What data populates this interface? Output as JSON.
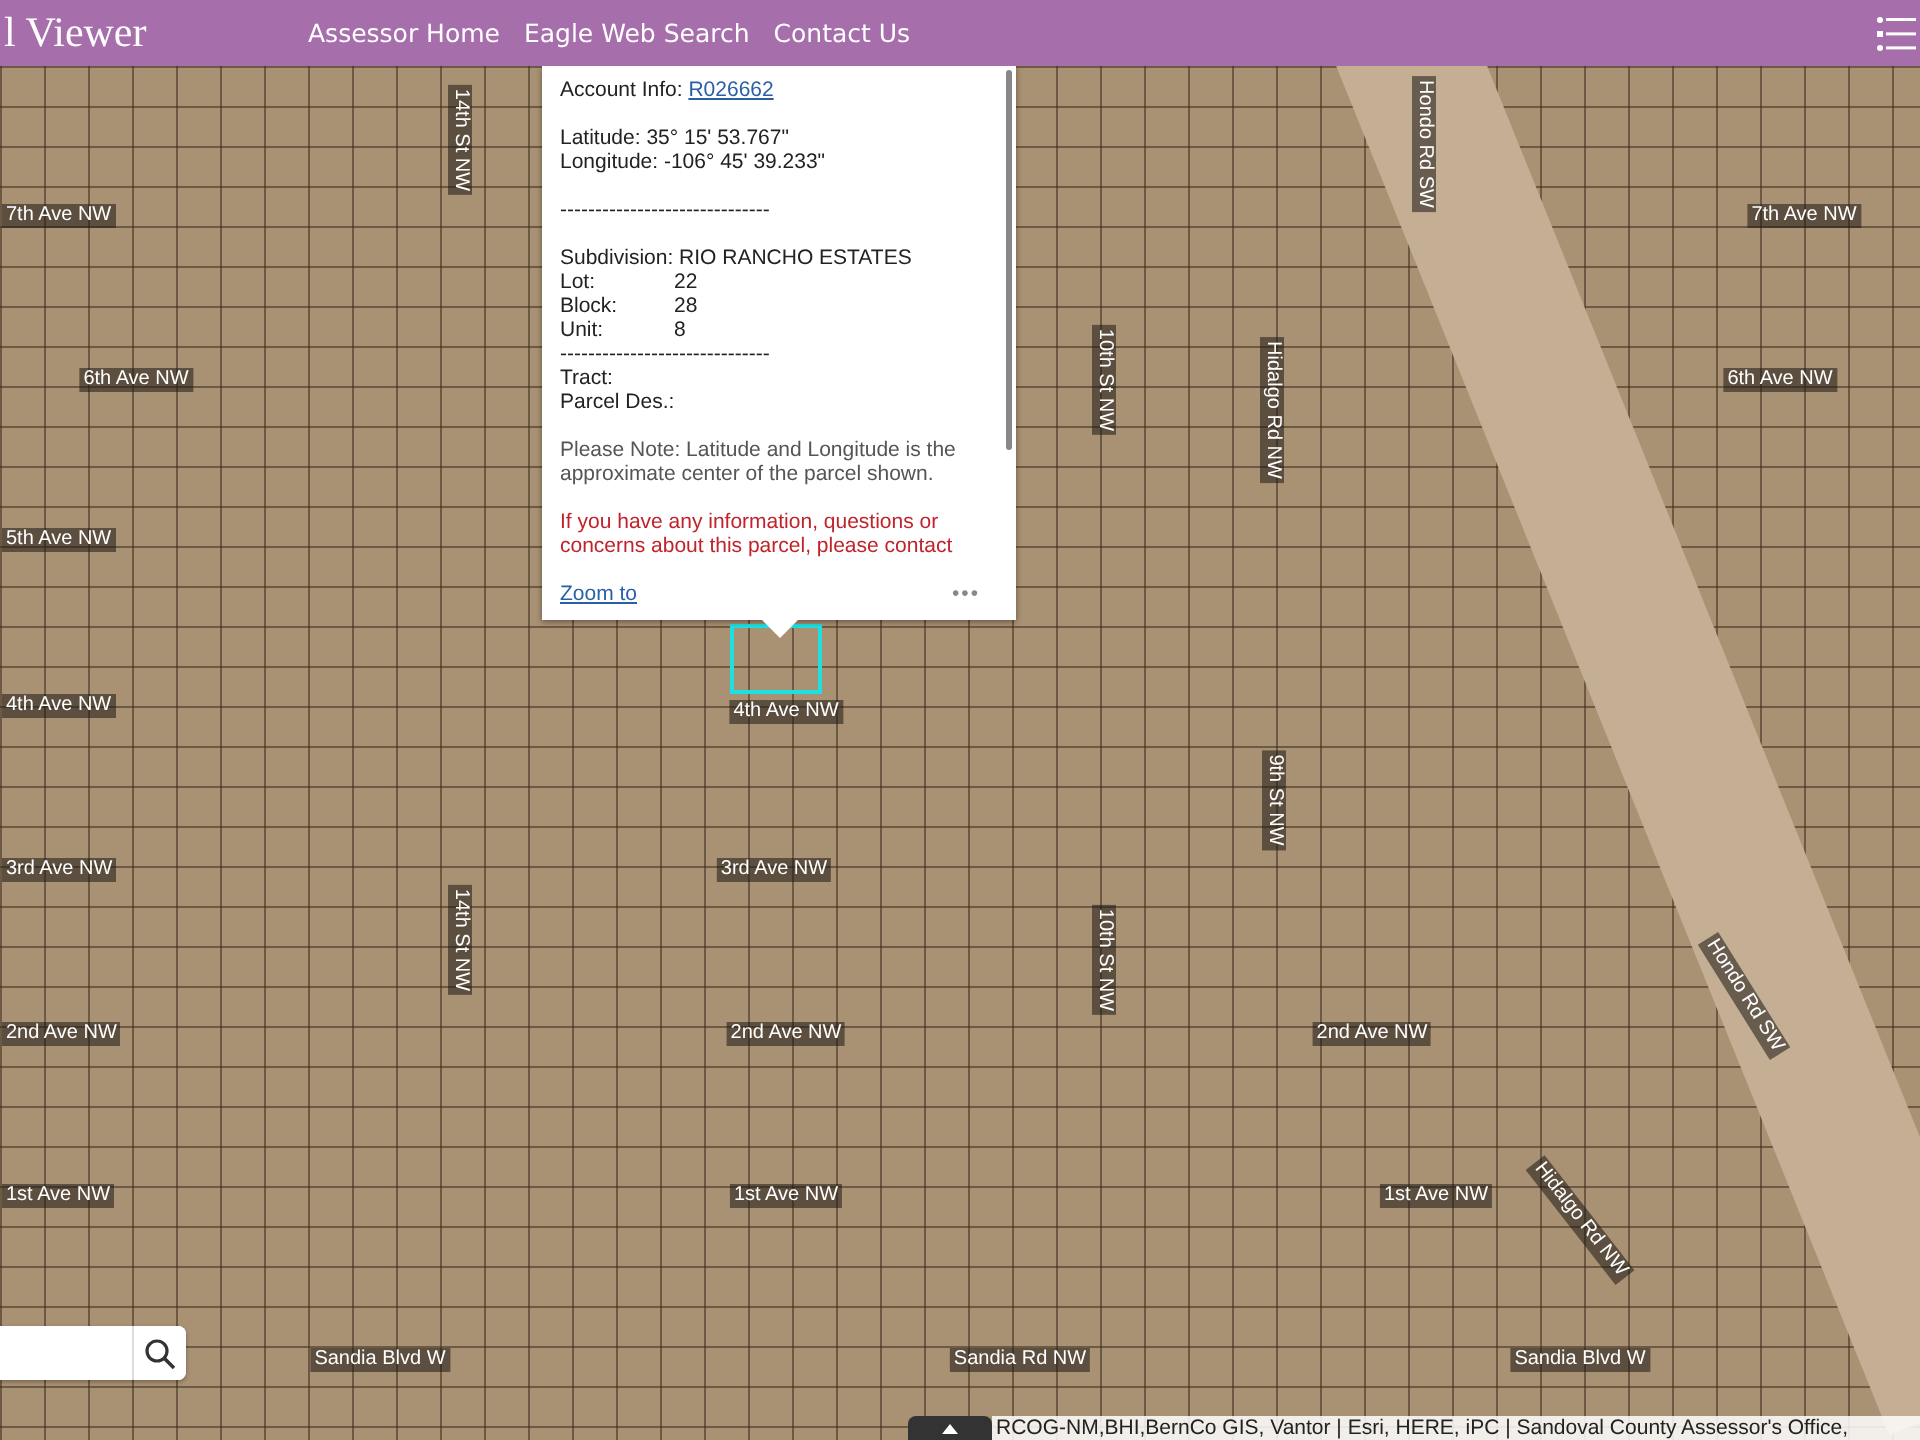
{
  "header": {
    "title": "l Viewer",
    "nav": [
      "Assessor Home",
      "Eagle Web Search",
      "Contact Us"
    ]
  },
  "map": {
    "street_labels": [
      {
        "text": "7th Ave NW",
        "kind": "horizontal"
      },
      {
        "text": "7th Ave NW",
        "kind": "horizontal"
      },
      {
        "text": "6th Ave NW",
        "kind": "horizontal"
      },
      {
        "text": "6th Ave NW",
        "kind": "horizontal"
      },
      {
        "text": "5th Ave NW",
        "kind": "horizontal"
      },
      {
        "text": "4th Ave NW",
        "kind": "horizontal"
      },
      {
        "text": "4th Ave NW",
        "kind": "horizontal"
      },
      {
        "text": "3rd Ave NW",
        "kind": "horizontal"
      },
      {
        "text": "3rd Ave NW",
        "kind": "horizontal"
      },
      {
        "text": "2nd Ave NW",
        "kind": "horizontal"
      },
      {
        "text": "2nd Ave NW",
        "kind": "horizontal"
      },
      {
        "text": "2nd Ave NW",
        "kind": "horizontal"
      },
      {
        "text": "1st Ave NW",
        "kind": "horizontal"
      },
      {
        "text": "1st Ave NW",
        "kind": "horizontal"
      },
      {
        "text": "1st Ave NW",
        "kind": "horizontal"
      },
      {
        "text": "Sandia Blvd W",
        "kind": "horizontal"
      },
      {
        "text": "Sandia Rd NW",
        "kind": "horizontal"
      },
      {
        "text": "Sandia Blvd W",
        "kind": "horizontal"
      },
      {
        "text": "14th St NW",
        "kind": "vertical"
      },
      {
        "text": "14th St NW",
        "kind": "vertical"
      },
      {
        "text": "10th St NW",
        "kind": "vertical"
      },
      {
        "text": "10th St NW",
        "kind": "vertical"
      },
      {
        "text": "Hidalgo Rd NW",
        "kind": "vertical"
      },
      {
        "text": "9th St NW",
        "kind": "vertical"
      },
      {
        "text": "Hondo Rd SW",
        "kind": "vertical"
      },
      {
        "text": "Hidalgo Rd NW",
        "kind": "diagonal"
      },
      {
        "text": "Hondo Rd SW",
        "kind": "diagonal"
      }
    ]
  },
  "popup": {
    "account_label": "Account Info:",
    "account_link": "R026662",
    "latitude": "Latitude: 35° 15' 53.767\"",
    "longitude": "Longitude: -106° 45' 39.233\"",
    "divider_1": "------------------------------",
    "subdivision": "Subdivision: RIO RANCHO ESTATES",
    "fields": [
      {
        "label": "Lot:",
        "value": "22"
      },
      {
        "label": "Block:",
        "value": "28"
      },
      {
        "label": "Unit:",
        "value": "8"
      }
    ],
    "divider_2": "------------------------------",
    "tract": "Tract:",
    "parcel_des": "Parcel Des.:",
    "note": "Please Note: Latitude and Longitude is the approximate center of the parcel shown.",
    "warning": "If you have any information, questions or concerns about this parcel, please contact",
    "zoom_link": "Zoom to",
    "more": "•••"
  },
  "attribution": "RCOG-NM,BHI,BernCo GIS, Vantor | Esri, HERE, iPC | Sandoval County Assessor's Office,"
}
